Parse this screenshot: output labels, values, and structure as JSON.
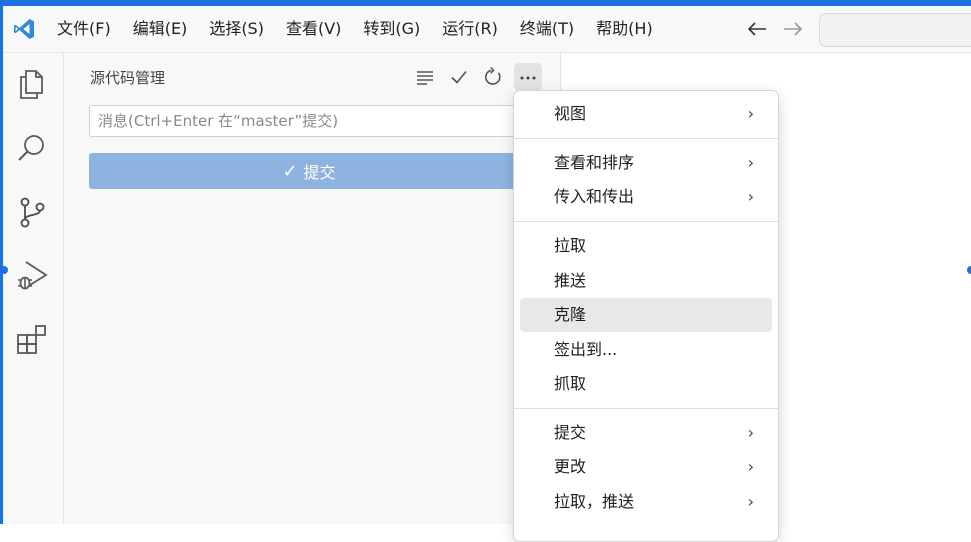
{
  "menubar": {
    "items": [
      "文件(F)",
      "编辑(E)",
      "选择(S)",
      "查看(V)",
      "转到(G)",
      "运行(R)",
      "终端(T)",
      "帮助(H)"
    ]
  },
  "navigation": {
    "back_icon": "arrow-left-icon",
    "forward_icon": "arrow-right-icon"
  },
  "activity_bar": {
    "icons": [
      "files-icon",
      "search-icon",
      "source-control-icon",
      "run-debug-icon",
      "extensions-icon"
    ]
  },
  "sidebar": {
    "title": "源代码管理",
    "actions": [
      "view-as-list-icon",
      "commit-check-icon",
      "refresh-icon",
      "more-actions-icon"
    ],
    "commit_placeholder": "消息(Ctrl+Enter 在“master”提交)",
    "commit_button_label": "提交"
  },
  "context_menu": {
    "items": [
      "视图",
      "查看和排序",
      "传入和传出",
      "拉取",
      "推送",
      "克隆",
      "签出到...",
      "抓取",
      "提交",
      "更改",
      "拉取，推送"
    ],
    "highlighted": "克隆",
    "submenu_chevron": "›"
  },
  "colors": {
    "accent": "#1e6fe0",
    "commit_button": "#8fb3e0",
    "vscode_logo": "#2f89d8"
  }
}
